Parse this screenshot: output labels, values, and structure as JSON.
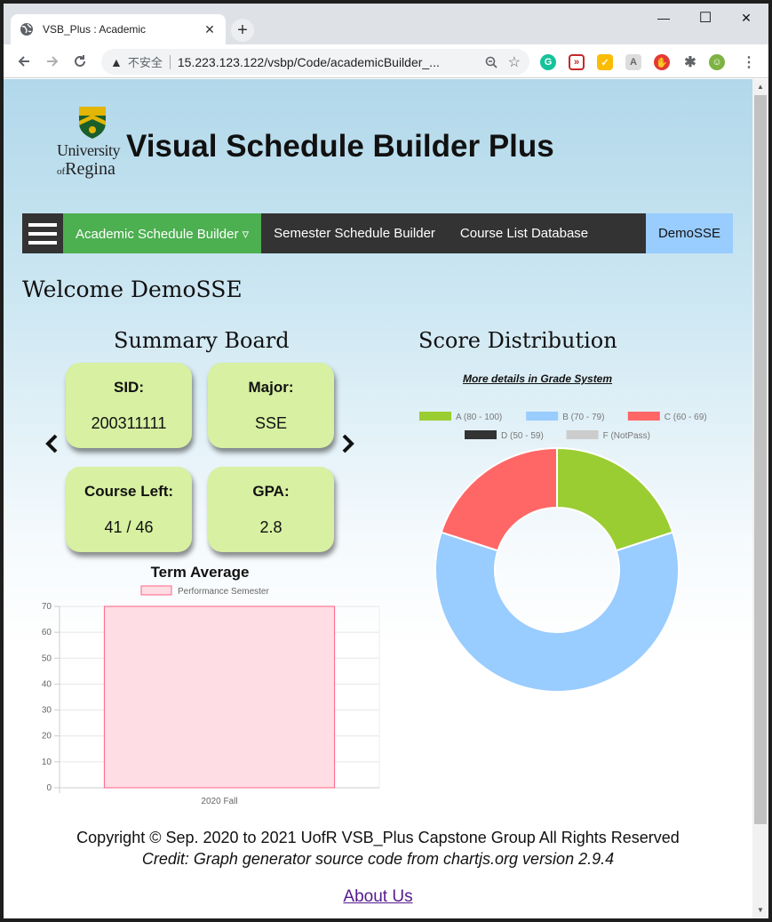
{
  "browser": {
    "tab_title": "VSB_Plus : Academic",
    "tab_close": "✕",
    "new_tab": "+",
    "security": "不安全",
    "url": "15.223.123.122/vsbp/Code/academicBuilder_...",
    "minimize": "—",
    "maximize": "☐",
    "close": "✕"
  },
  "header": {
    "logo_line1": "University",
    "logo_of": "of",
    "logo_line2": "Regina",
    "title": "Visual Schedule Builder Plus"
  },
  "nav": {
    "items": [
      {
        "label": "Academic Schedule Builder ▿"
      },
      {
        "label": "Semester Schedule Builder"
      },
      {
        "label": "Course List Database"
      }
    ],
    "user": "DemoSSE"
  },
  "welcome": "Welcome DemoSSE",
  "summary": {
    "title": "Summary Board",
    "prev": "‹",
    "next": "›",
    "cards": [
      {
        "label": "SID:",
        "value": "200311111"
      },
      {
        "label": "Major:",
        "value": "SSE"
      },
      {
        "label": "Course Left:",
        "value": "41 / 46"
      },
      {
        "label": "GPA:",
        "value": "2.8"
      }
    ]
  },
  "score": {
    "title": "Score Distribution",
    "details_link": "More details in Grade System"
  },
  "chart_data": [
    {
      "type": "bar",
      "title": "Term Average",
      "categories": [
        "2020 Fall"
      ],
      "series": [
        {
          "name": "Performance Semester",
          "values": [
            70
          ]
        }
      ],
      "ylim": [
        0,
        70
      ],
      "yticks": [
        0,
        10,
        20,
        30,
        40,
        50,
        60,
        70
      ],
      "grid": true,
      "legend": "top",
      "colors": {
        "fill": "#ffdde4",
        "border": "#ff6384"
      }
    },
    {
      "type": "pie",
      "donut": true,
      "legend": "top",
      "labels": [
        "A (80 - 100)",
        "B (70 - 79)",
        "C (60 - 69)",
        "D (50 - 59)",
        "F (NotPass)"
      ],
      "values": [
        1,
        3,
        1,
        0,
        0
      ],
      "colors": [
        "#9acd32",
        "#99ccff",
        "#ff6666",
        "#333333",
        "#cccccc"
      ],
      "tooltip": "B (70 - 79): 3"
    }
  ],
  "footer": {
    "copyright": "Copyright © Sep. 2020 to 2021 UofR VSB_Plus Capstone Group All Rights Reserved",
    "credit": "Credit: Graph generator source code from chartjs.org version 2.9.4",
    "about": "About Us"
  }
}
